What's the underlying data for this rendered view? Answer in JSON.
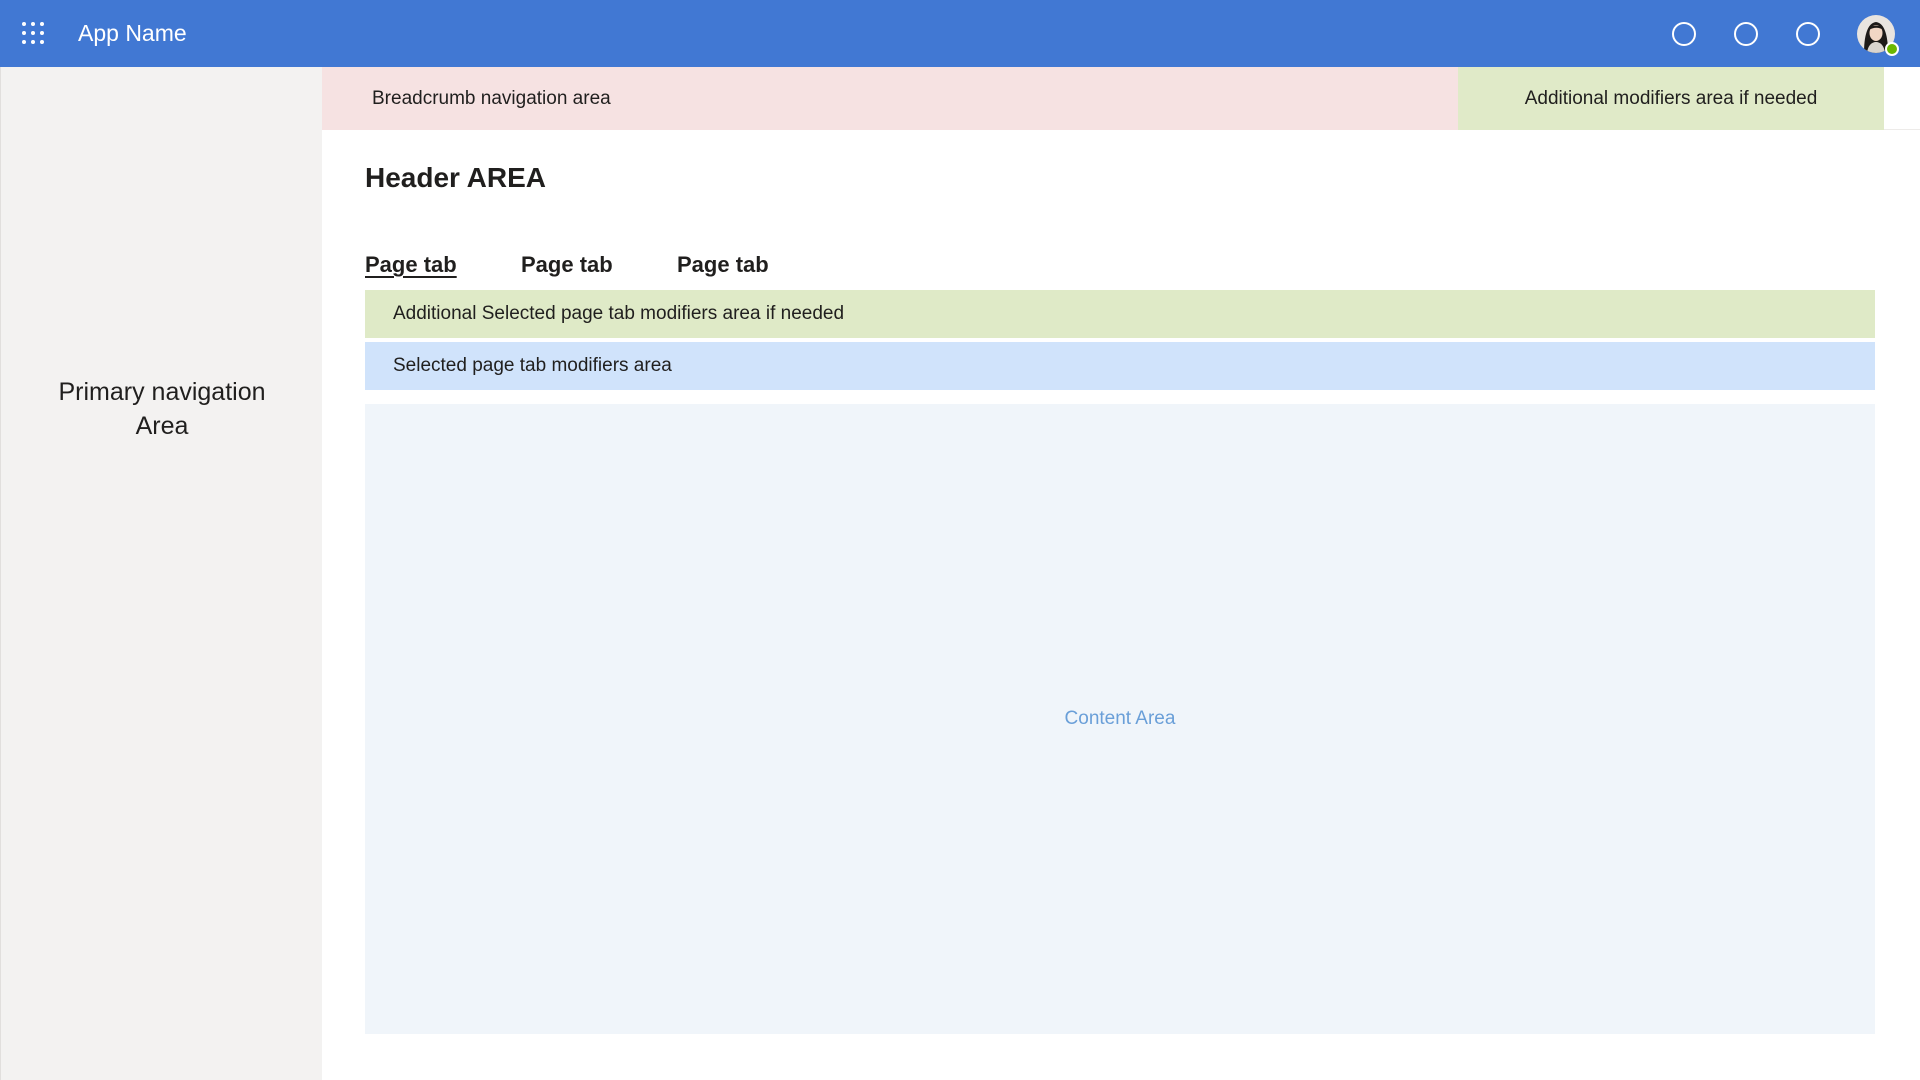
{
  "topbar": {
    "app_name": "App Name",
    "icons": [
      "circle-icon",
      "circle-icon",
      "circle-icon"
    ],
    "background": "#4178d3"
  },
  "user": {
    "status": "online",
    "status_color": "#6bb700"
  },
  "leftnav": {
    "label_line1": "Primary navigation",
    "label_line2": "Area"
  },
  "breadcrumb": {
    "label": "Breadcrumb navigation area"
  },
  "top_modifiers": {
    "label": "Additional modifiers area if needed"
  },
  "header": {
    "title": "Header AREA"
  },
  "tabs": [
    {
      "label": "Page tab",
      "selected": true
    },
    {
      "label": "Page tab",
      "selected": false
    },
    {
      "label": "Page tab",
      "selected": false
    }
  ],
  "tab_modifiers": {
    "additional_label": "Additional Selected page tab modifiers area if needed",
    "selected_label": "Selected page tab modifiers area"
  },
  "content": {
    "label": "Content Area"
  }
}
